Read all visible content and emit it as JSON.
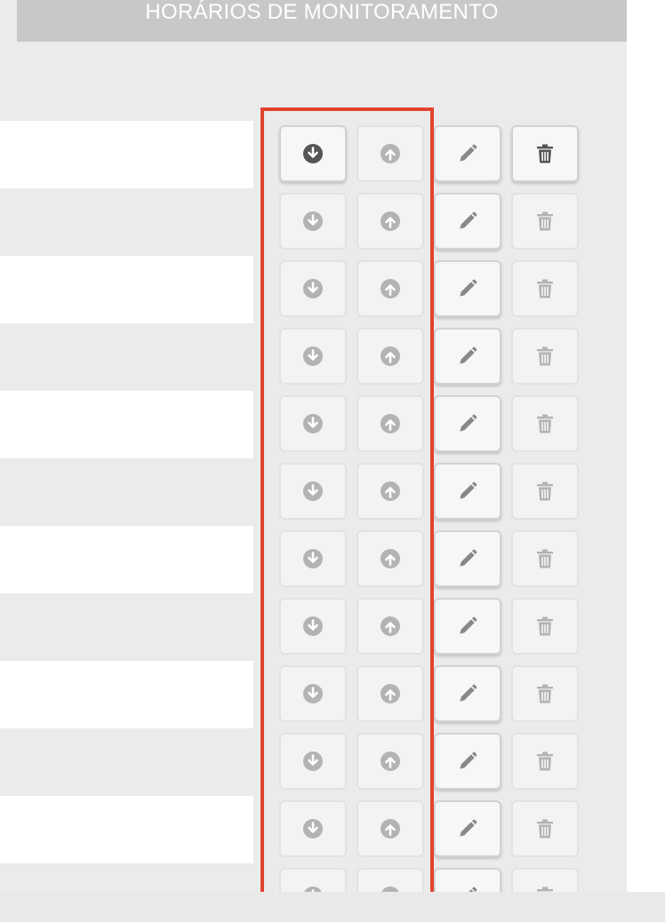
{
  "header": {
    "title": "HORÁRIOS DE MONITORAMENTO"
  },
  "colors": {
    "stripe_white": "#ffffff",
    "stripe_gray": "#ebebeb",
    "icon_active": "#555555",
    "icon_muted": "#b3b3b3",
    "icon_edit": "#888888",
    "highlight_border": "#e0442f"
  },
  "row_actions": {
    "icons": [
      "arrow-down-circle-icon",
      "arrow-up-circle-icon",
      "pencil-icon",
      "trash-icon"
    ]
  },
  "rows": [
    {
      "first": true
    },
    {},
    {},
    {},
    {},
    {},
    {},
    {},
    {},
    {},
    {},
    {}
  ]
}
